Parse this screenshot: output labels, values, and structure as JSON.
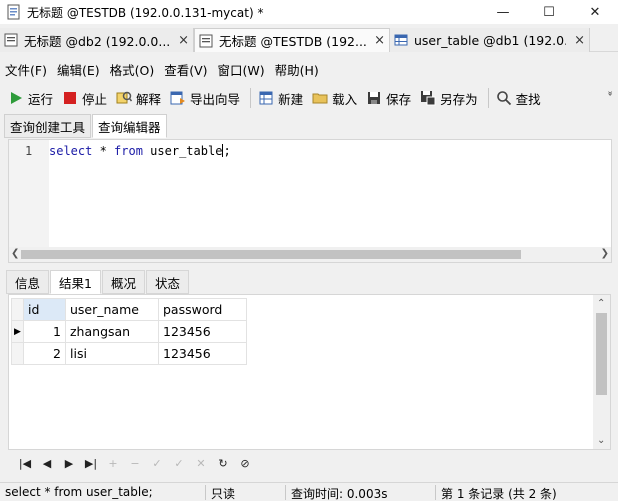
{
  "window": {
    "title": "无标题 @TESTDB (192.0.0.131-mycat) *"
  },
  "doc_tabs": [
    {
      "label": "无标题 @db2 (192.0.0....",
      "close": "×"
    },
    {
      "label": "无标题 @TESTDB (192....",
      "close": "×"
    },
    {
      "label": "user_table @db1 (192.0....",
      "close": "×"
    }
  ],
  "menu": [
    "文件(F)",
    "编辑(E)",
    "格式(O)",
    "查看(V)",
    "窗口(W)",
    "帮助(H)"
  ],
  "toolbar": {
    "run": "运行",
    "stop": "停止",
    "explain": "解释",
    "export_wizard": "导出向导",
    "new": "新建",
    "load": "载入",
    "save": "保存",
    "save_as": "另存为",
    "find": "查找",
    "more": "»"
  },
  "editor_tabs": [
    "查询创建工具",
    "查询编辑器"
  ],
  "editor": {
    "line_number": "1",
    "kw_select": "select",
    "star": " * ",
    "kw_from": "from",
    "table_text": " user_table",
    "semicolon": ";"
  },
  "result_tabs": [
    "信息",
    "结果1",
    "概况",
    "状态"
  ],
  "grid": {
    "columns": [
      "id",
      "user_name",
      "password"
    ],
    "rows": [
      {
        "id": "1",
        "user_name": "zhangsan",
        "password": "123456"
      },
      {
        "id": "2",
        "user_name": "lisi",
        "password": "123456"
      }
    ],
    "current_row_marker": "▶"
  },
  "nav_buttons": [
    "|◀",
    "◀",
    "▶",
    "▶|",
    "+",
    "−",
    "✓",
    "✓",
    "✕",
    "↻",
    "⊘"
  ],
  "status": {
    "sql": "select * from user_table;",
    "mode": "只读",
    "query_time": "查询时间: 0.003s",
    "record_info": "第 1 条记录 (共 2 条)"
  }
}
